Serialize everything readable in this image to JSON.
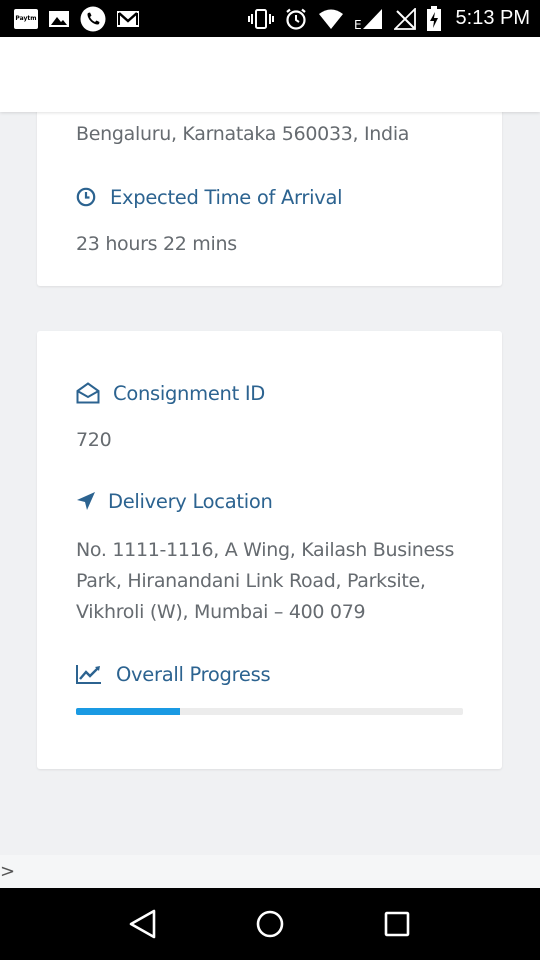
{
  "status_bar": {
    "time": "5:13 PM",
    "left_icons": [
      "paytm-icon",
      "gallery-icon",
      "phone-icon",
      "gmail-icon"
    ],
    "paytm_label": "Paytm",
    "right_icons": [
      "vibrate-icon",
      "alarm-icon",
      "wifi-icon",
      "signal-icon",
      "no-signal-icon",
      "battery-icon"
    ],
    "network_type": "E"
  },
  "card_top": {
    "address_cut": "Bengaluru, Karnataka 560033, India",
    "eta_label": "Expected Time of Arrival",
    "eta_value": "23 hours 22 mins"
  },
  "card_details": {
    "consignment_label": "Consignment ID",
    "consignment_value": "720",
    "delivery_label": "Delivery Location",
    "delivery_lines": [
      "No. 1111-1116, A Wing, Kailash Business",
      "Park, Hiranandani Link Road, Parksite,",
      "Vikhroli (W), Mumbai – 400 079"
    ],
    "progress_label": "Overall Progress",
    "progress_fraction": 0.27
  },
  "footer": {
    "caret": ">"
  },
  "colors": {
    "accent": "#2c6390",
    "progress": "#1a9ae3",
    "body_text": "#666b70"
  }
}
